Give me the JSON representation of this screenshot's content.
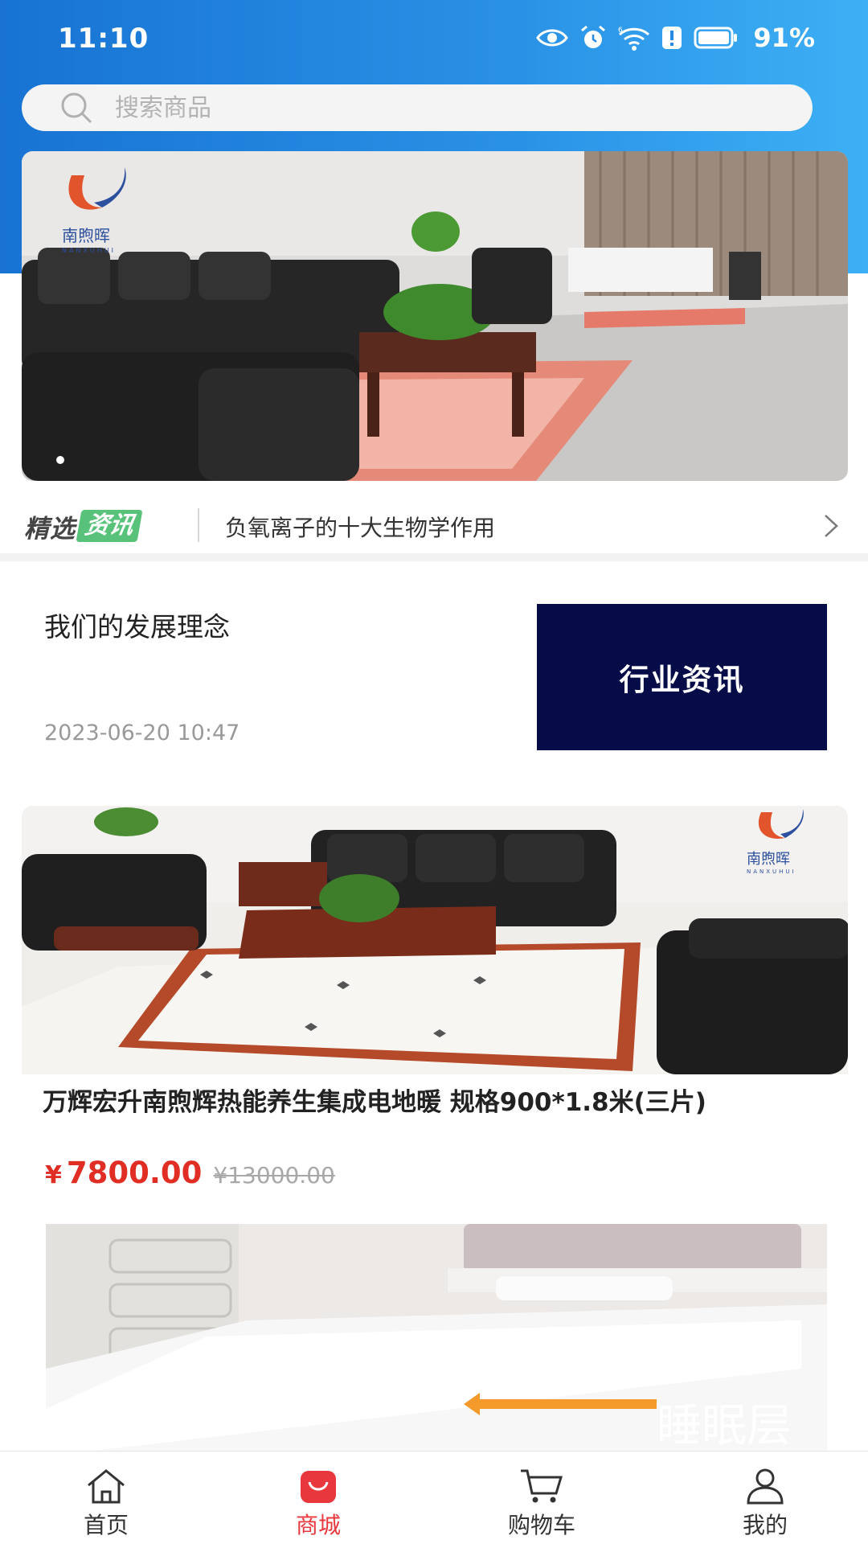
{
  "status_bar": {
    "time": "11:10",
    "battery": "91%",
    "icons": [
      "eye-icon",
      "alarm-icon",
      "wifi-6-icon",
      "notification-icon",
      "battery-icon"
    ]
  },
  "search": {
    "placeholder": "搜索商品",
    "value": ""
  },
  "banner": {
    "brand": "南煦晖",
    "brand_en": "NANXUHUI",
    "active_dot": 1
  },
  "news": {
    "badge_left": "精选",
    "badge_right": "资讯",
    "headline": "负氧离子的十大生物学作用"
  },
  "article": {
    "title": "我们的发展理念",
    "date": "2023-06-20 10:47",
    "thumb_text": "行业资讯"
  },
  "products": [
    {
      "title": "万辉宏升南煦辉热能养生集成电地暖 规格900*1.8米(三片)",
      "currency": "¥",
      "price": "7800.00",
      "original_price": "¥13000.00",
      "image_brand": "南煦晖",
      "image_brand_en": "NANXUHUI"
    },
    {
      "image_caption": "睡眠层"
    }
  ],
  "tabbar": {
    "items": [
      {
        "label": "首页",
        "icon": "home-icon",
        "active": false
      },
      {
        "label": "商城",
        "icon": "shopping-bag-icon",
        "active": true
      },
      {
        "label": "购物车",
        "icon": "cart-icon",
        "active": false
      },
      {
        "label": "我的",
        "icon": "user-icon",
        "active": false
      }
    ]
  },
  "colors": {
    "header_gradient_start": "#1873d3",
    "header_gradient_end": "#3db0f5",
    "price_red": "#e02e24",
    "active_tab_red": "#e8383d",
    "thumb_navy": "#050c47",
    "badge_green": "#58c27a"
  }
}
